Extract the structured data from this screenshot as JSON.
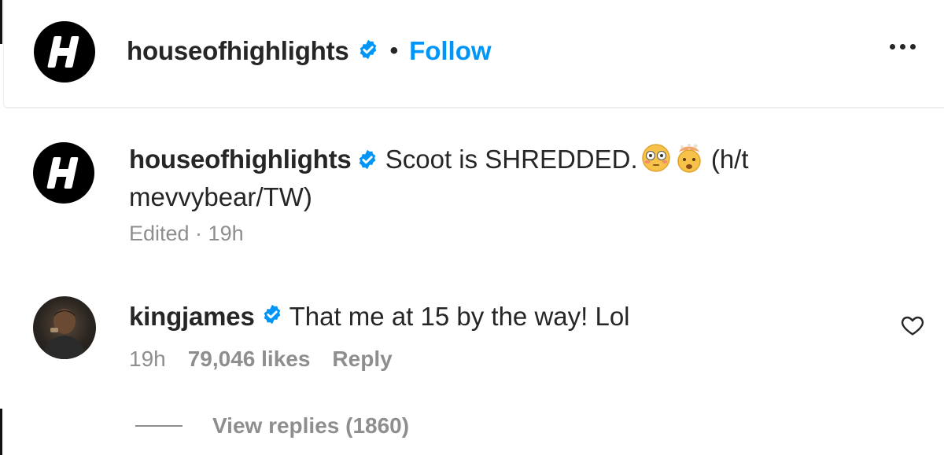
{
  "colors": {
    "accent": "#0095f6",
    "verified": "#0095f6",
    "text": "#262626",
    "muted": "#8e8e8e"
  },
  "header": {
    "username": "houseofhighlights",
    "separator": "•",
    "follow_label": "Follow",
    "more_icon": "more-horizontal-icon"
  },
  "caption": {
    "username": "houseofhighlights",
    "text_before": "Scoot is SHREDDED.",
    "emojis": [
      "flushed-face-icon",
      "exploding-head-icon"
    ],
    "text_after": "(h/t mevvybear/TW)",
    "meta": "Edited · 19h"
  },
  "comment": {
    "username": "kingjames",
    "text": "That me at 15 by the way! Lol",
    "time": "19h",
    "likes": "79,046 likes",
    "reply_label": "Reply",
    "like_icon": "heart-outline-icon"
  },
  "view_replies": {
    "label": "View replies (1860)"
  }
}
